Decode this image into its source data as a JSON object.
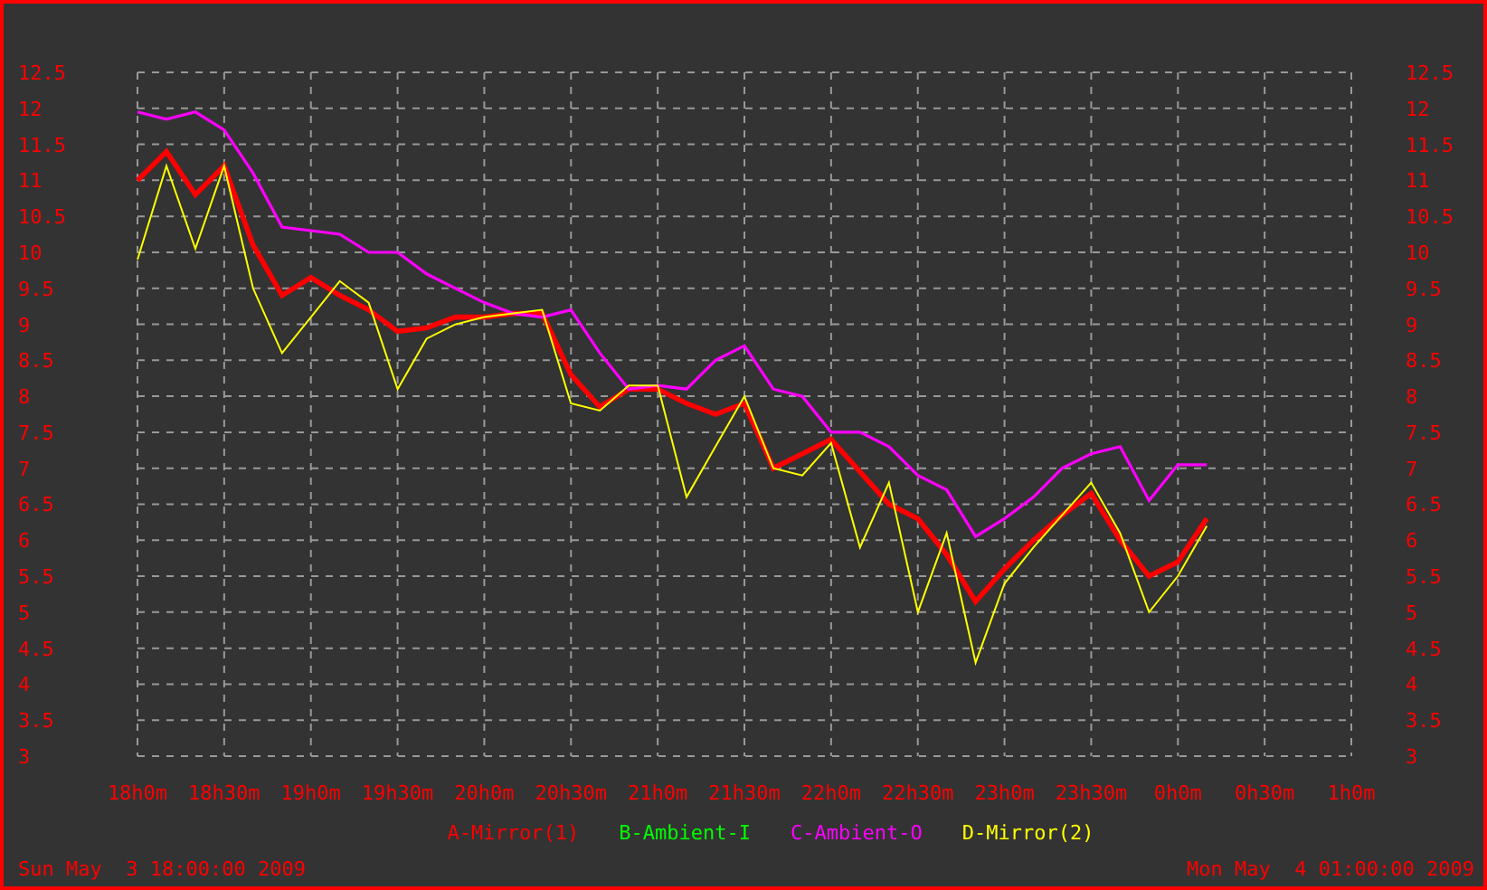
{
  "chart_data": {
    "type": "line",
    "categories": [
      "18h0m",
      null,
      null,
      "18h30m",
      null,
      null,
      "19h0m",
      null,
      null,
      "19h30m",
      null,
      null,
      "20h0m",
      null,
      null,
      "20h30m",
      null,
      null,
      "21h0m",
      null,
      null,
      "21h30m",
      null,
      null,
      "22h0m",
      null,
      null,
      "22h30m",
      null,
      null,
      "23h0m",
      null,
      null,
      "23h30m",
      null,
      null,
      "0h0m",
      null,
      null,
      "0h30m",
      null,
      null,
      "1h0m"
    ],
    "series": [
      {
        "name": "A-Mirror(1)",
        "color": "#ff0000",
        "values": [
          11.0,
          11.4,
          10.8,
          11.2,
          10.1,
          9.4,
          9.65,
          9.4,
          9.2,
          8.9,
          8.95,
          9.1,
          9.1,
          9.15,
          9.15,
          8.3,
          7.85,
          8.1,
          8.1,
          7.9,
          7.75,
          7.9,
          7.0,
          7.2,
          7.4,
          6.95,
          6.5,
          6.3,
          5.8,
          5.15,
          5.6,
          6.0,
          6.35,
          6.65,
          6.0,
          5.5,
          5.7,
          6.3,
          null,
          null,
          null,
          null,
          null
        ]
      },
      {
        "name": "B-Ambient-I",
        "color": "#00ff00",
        "values": [
          null,
          null,
          null,
          null,
          null,
          null,
          null,
          null,
          null,
          null,
          null,
          null,
          null,
          null,
          null,
          null,
          null,
          null,
          null,
          null,
          null,
          null,
          null,
          null,
          null,
          null,
          null,
          null,
          null,
          null,
          null,
          null,
          null,
          null,
          null,
          null,
          null,
          null,
          null,
          null,
          null,
          null,
          null
        ]
      },
      {
        "name": "C-Ambient-O",
        "color": "#ff00ff",
        "values": [
          11.95,
          11.85,
          11.95,
          11.7,
          11.1,
          10.35,
          10.3,
          10.25,
          10.0,
          10.0,
          9.7,
          9.5,
          9.3,
          9.15,
          9.1,
          9.2,
          8.6,
          8.1,
          8.15,
          8.1,
          8.5,
          8.7,
          8.1,
          8.0,
          7.5,
          7.5,
          7.3,
          6.9,
          6.7,
          6.05,
          6.3,
          6.6,
          7.0,
          7.2,
          7.3,
          6.55,
          7.05,
          7.05,
          null,
          null,
          null,
          null,
          null
        ]
      },
      {
        "name": "D-Mirror(2)",
        "color": "#ffff00",
        "values": [
          9.9,
          11.2,
          10.05,
          11.2,
          9.5,
          8.6,
          9.1,
          9.6,
          9.3,
          8.1,
          8.8,
          9.0,
          9.1,
          9.15,
          9.2,
          7.9,
          7.8,
          8.15,
          8.15,
          6.6,
          7.3,
          8.0,
          7.0,
          6.9,
          7.35,
          5.9,
          6.8,
          5.0,
          6.1,
          4.3,
          5.4,
          5.9,
          6.35,
          6.8,
          6.1,
          5.0,
          5.5,
          6.2,
          null,
          null,
          null,
          null,
          null
        ]
      }
    ],
    "grid": true,
    "ylim": [
      3,
      12.5
    ],
    "yticks": [
      3,
      3.5,
      4,
      4.5,
      5,
      5.5,
      6,
      6.5,
      7,
      7.5,
      8,
      8.5,
      9,
      9.5,
      10,
      10.5,
      11,
      11.5,
      12,
      12.5
    ]
  },
  "left_axis": {
    "ticks": [
      "12.5",
      "12",
      "11.5",
      "11",
      "10.5",
      "10",
      "9.5",
      "9",
      "8.5",
      "8",
      "7.5",
      "7",
      "6.5",
      "6",
      "5.5",
      "5",
      "4.5",
      "4",
      "3.5",
      "3"
    ]
  },
  "footer": {
    "start": "Sun May  3 18:00:00 2009",
    "end": "Mon May  4 01:00:00 2009"
  }
}
